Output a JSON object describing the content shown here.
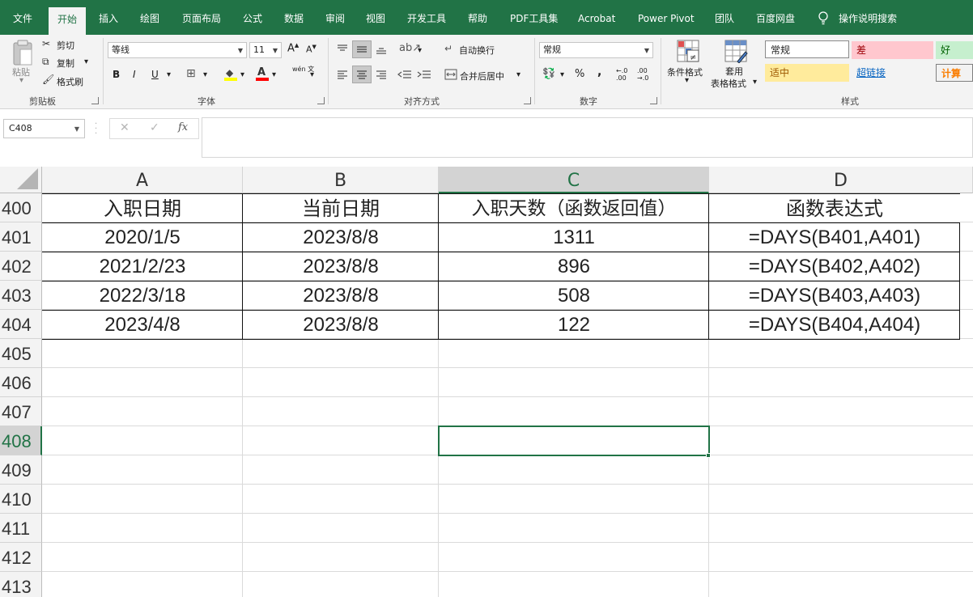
{
  "menu": {
    "tabs": [
      "文件",
      "开始",
      "插入",
      "绘图",
      "页面布局",
      "公式",
      "数据",
      "审阅",
      "视图",
      "开发工具",
      "帮助",
      "PDF工具集",
      "Acrobat",
      "Power Pivot",
      "团队",
      "百度网盘",
      "操作说明搜索"
    ],
    "active_tab": "开始"
  },
  "ribbon": {
    "clipboard": {
      "paste": "粘贴",
      "cut": "剪切",
      "copy": "复制",
      "format_painter": "格式刷",
      "label": "剪贴板"
    },
    "font": {
      "name": "等线",
      "size": "11",
      "bold": "B",
      "italic": "I",
      "underline": "U",
      "label": "字体",
      "phonetic": "wén 文"
    },
    "alignment": {
      "wrap": "自动换行",
      "merge": "合并后居中",
      "label": "对齐方式"
    },
    "number": {
      "format": "常规",
      "percent": "%",
      "comma": ",",
      "inc_decimal": "←.0 .00",
      "dec_decimal": ".00 →.0",
      "label": "数字"
    },
    "styles": {
      "conditional": "条件格式",
      "table_line1": "套用",
      "table_line2": "表格格式",
      "cells": [
        "常规",
        "差",
        "好",
        "适中",
        "超链接",
        "计算"
      ],
      "label": "样式"
    }
  },
  "formula_bar": {
    "name_box": "C408",
    "cancel": "✕",
    "enter": "✓",
    "fx": "fx",
    "content": ""
  },
  "colors": {
    "excel_green": "#217346",
    "bad_bg": "#ffc7ce",
    "bad_fg": "#9c0006",
    "good_bg": "#c6efce",
    "good_fg": "#006100",
    "neutral_bg": "#ffeb9c",
    "neutral_fg": "#9c5700",
    "hyperlink": "#0563c1",
    "calc_fg": "#fa7d00"
  },
  "sheet": {
    "columns": [
      "A",
      "B",
      "C",
      "D"
    ],
    "selected_column": "C",
    "rows": [
      "400",
      "401",
      "402",
      "403",
      "404",
      "405",
      "406",
      "407",
      "408",
      "409",
      "410",
      "411",
      "412",
      "413"
    ],
    "selected_row": "408",
    "active_cell": "C408",
    "table": {
      "headers": [
        "入职日期",
        "当前日期",
        "入职天数（函数返回值）",
        "函数表达式"
      ],
      "data": [
        [
          "2020/1/5",
          "2023/8/8",
          "1311",
          "=DAYS(B401,A401)"
        ],
        [
          "2021/2/23",
          "2023/8/8",
          "896",
          "=DAYS(B402,A402)"
        ],
        [
          "2022/3/18",
          "2023/8/8",
          "508",
          "=DAYS(B403,A403)"
        ],
        [
          "2023/4/8",
          "2023/8/8",
          "122",
          "=DAYS(B404,A404)"
        ]
      ]
    }
  }
}
